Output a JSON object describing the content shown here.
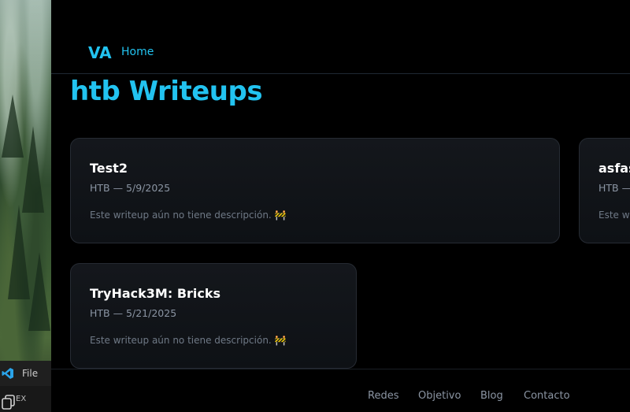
{
  "taskbar": {
    "file_label": "File",
    "explorer_label": "EX"
  },
  "nav": {
    "brand": "VA",
    "home_label": "Home"
  },
  "page": {
    "title": "htb Writeups"
  },
  "cards": [
    {
      "title": "Test2",
      "meta": "HTB — 5/9/2025",
      "description": "Este writeup aún no tiene descripción. 🚧"
    },
    {
      "title": "asfas",
      "meta": "HTB —",
      "description": "Este wr"
    },
    {
      "title": "TryHack3M: Bricks",
      "meta": "HTB — 5/21/2025",
      "description": "Este writeup aún no tiene descripción. 🚧"
    }
  ],
  "footer": {
    "links": [
      "Redes",
      "Objetivo",
      "Blog",
      "Contacto"
    ]
  },
  "colors": {
    "accent": "#22c3f0",
    "background": "#000000",
    "card": "#14171c"
  },
  "icons": {
    "vscode": "vscode-icon",
    "copy": "copy-icon"
  }
}
